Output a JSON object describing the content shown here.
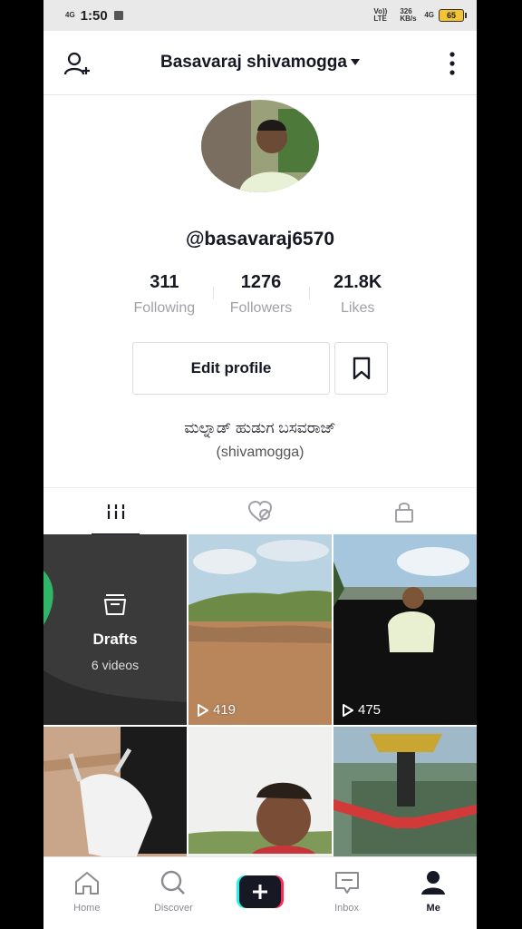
{
  "status_bar": {
    "network_left": "4G",
    "time": "1:50",
    "right_lte": "Vo)) LTE",
    "speed": "326 KB/s",
    "network_right": "4G",
    "battery": "65"
  },
  "header": {
    "title": "Basavaraj shivamogga"
  },
  "profile": {
    "handle": "@basavaraj6570",
    "stats": [
      {
        "value": "311",
        "label": "Following"
      },
      {
        "value": "1276",
        "label": "Followers"
      },
      {
        "value": "21.8K",
        "label": "Likes"
      }
    ],
    "edit_label": "Edit profile",
    "bio_line1": "ಮಲ್ನಾಡ್ ಹುಡುಗ ಬಸವರಾಜ್",
    "bio_line2": "(shivamogga)"
  },
  "grid": {
    "drafts_title": "Drafts",
    "drafts_count": "6 videos",
    "videos": [
      {
        "views": "419"
      },
      {
        "views": "475"
      }
    ]
  },
  "nav": {
    "items": [
      {
        "label": "Home"
      },
      {
        "label": "Discover"
      },
      {
        "label": ""
      },
      {
        "label": "Inbox"
      },
      {
        "label": "Me"
      }
    ]
  }
}
